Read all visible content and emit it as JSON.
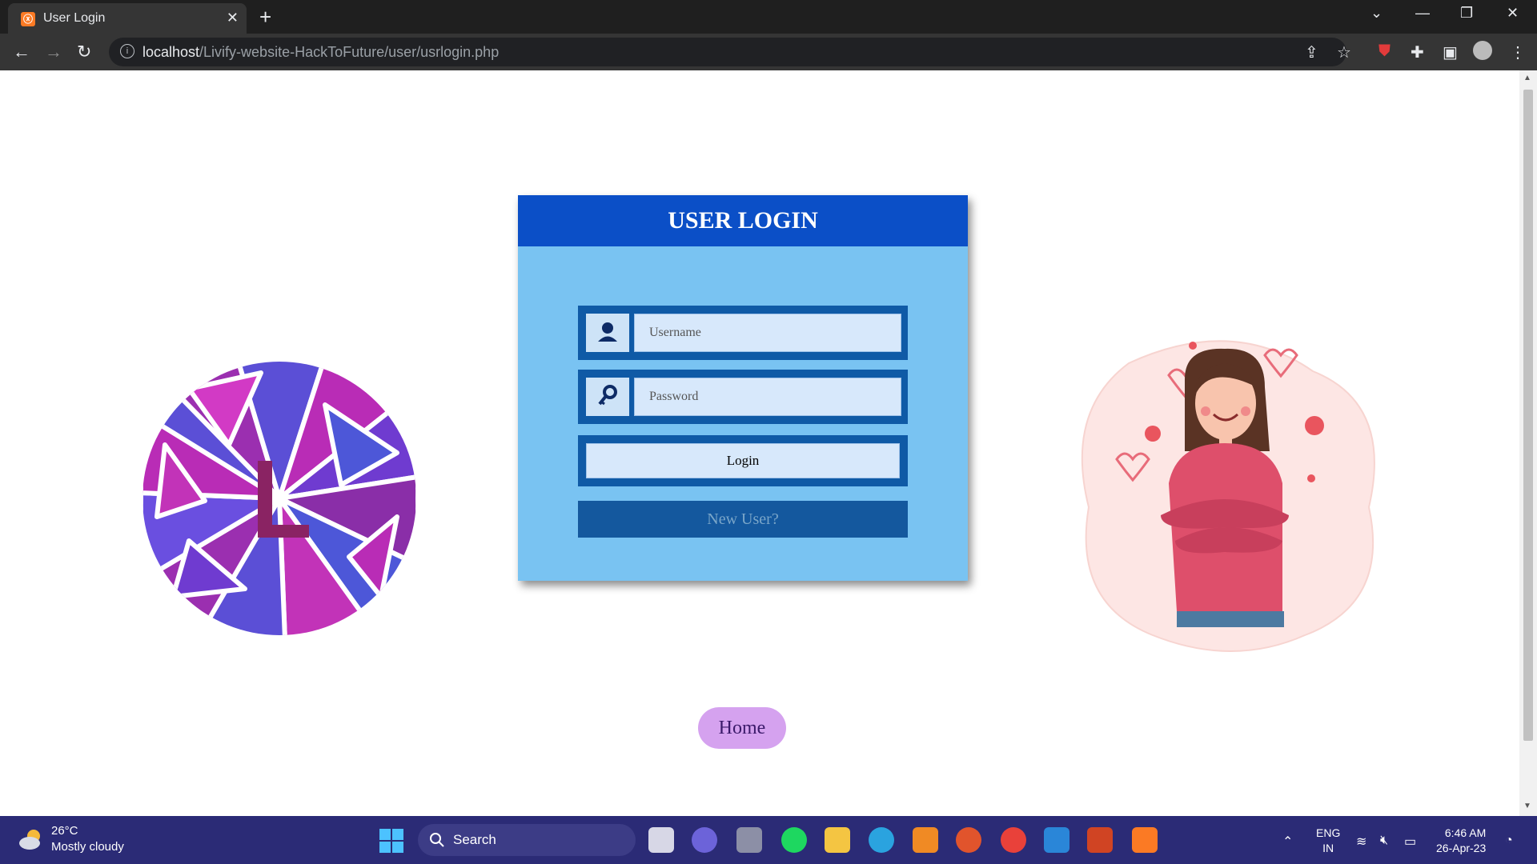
{
  "browser": {
    "tab_title": "User Login",
    "url_host": "localhost",
    "url_path": "/Livify-website-HackToFuture/user/usrlogin.php"
  },
  "login": {
    "title": "USER LOGIN",
    "username_placeholder": "Username",
    "password_placeholder": "Password",
    "login_button": "Login",
    "new_user_button": "New User?"
  },
  "home_button": "Home",
  "taskbar": {
    "weather_temp": "26°C",
    "weather_desc": "Mostly cloudy",
    "search_label": "Search",
    "lang_top": "ENG",
    "lang_bottom": "IN",
    "time": "6:46 AM",
    "date": "26-Apr-23"
  },
  "colors": {
    "card_header": "#0b4fc7",
    "card_body": "#79c3f2",
    "field_frame": "#0f5aa6",
    "home_button": "#d5a2ef",
    "taskbar": "#2b2b76"
  }
}
